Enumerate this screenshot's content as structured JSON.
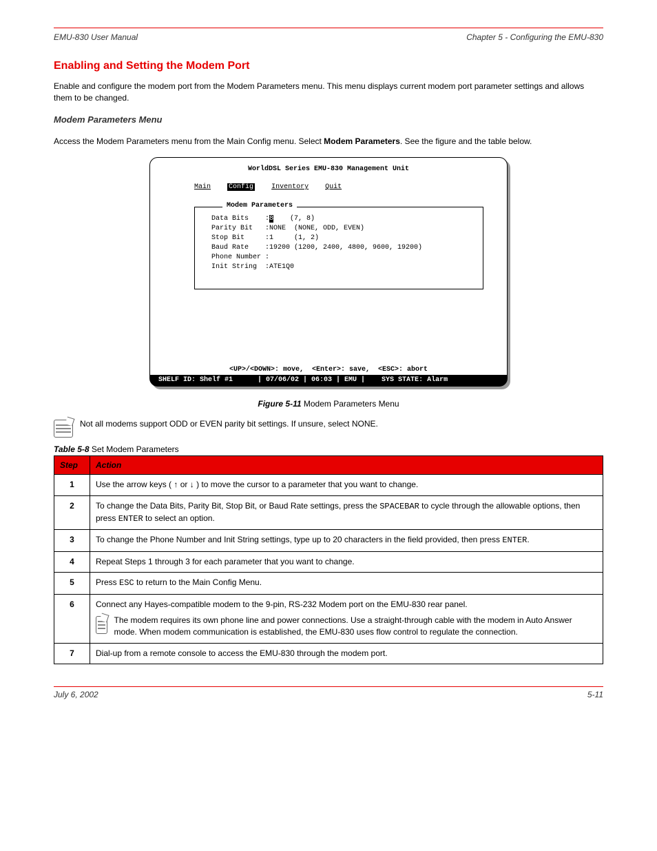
{
  "header": {
    "left": "EMU-830 User Manual",
    "right": "Chapter 5 - Configuring the EMU-830"
  },
  "section_title": "Enabling and Setting the Modem Port",
  "intro": "Enable and configure the modem port from the Modem Parameters menu. This menu displays current modem port parameter settings and allows them to be changed.",
  "subheading": "Modem Parameters Menu",
  "access_prefix": "Access the Modem Parameters menu from the Main Config menu. Select ",
  "access_bold": "Modem Parameters",
  "access_suffix": ". See the figure and the table below.",
  "terminal": {
    "title": "WorldDSL Series EMU-830 Management Unit",
    "menu": {
      "main": "Main",
      "config": "Config",
      "inventory": "Inventory",
      "quit": "Quit"
    },
    "panel_legend": "Modem Parameters",
    "rows": [
      {
        "label": "Data Bits    :",
        "value": "8",
        "hint": "(7, 8)"
      },
      {
        "label": "Parity Bit   :",
        "value": "NONE ",
        "hint": "(NONE, ODD, EVEN)"
      },
      {
        "label": "Stop Bit     :",
        "value": "1    ",
        "hint": "(1, 2)"
      },
      {
        "label": "Baud Rate    :",
        "value": "19200",
        "hint": "(1200, 2400, 4800, 9600, 19200)"
      },
      {
        "label": "Phone Number :",
        "value": "",
        "hint": ""
      },
      {
        "label": "Init String  :",
        "value": "ATE1Q0",
        "hint": ""
      }
    ],
    "help": "<UP>/<DOWN>: move,  <Enter>: save,  <ESC>: abort",
    "status": " SHELF ID: Shelf #1      | 07/06/02 | 06:03 | EMU |    SYS STATE: Alarm  "
  },
  "figure_caption_label": "Figure 5-11  ",
  "figure_caption_text": "Modem Parameters Menu",
  "note_outer": "Not all modems support ODD or EVEN parity bit settings. If unsure, select NONE.",
  "table_caption_label": "Table 5-8  ",
  "table_caption_text": "Set Modem Parameters",
  "table": {
    "headers": {
      "step": "Step",
      "action": "Action"
    },
    "rows": [
      {
        "num": "1",
        "parts": [
          {
            "t": "Use the arrow keys ("
          },
          {
            "t": " ↑ ",
            "cls": "arrow-box"
          },
          {
            "t": " or "
          },
          {
            "t": " ↓ ",
            "cls": "arrow-box"
          },
          {
            "t": " ) to move the cursor to a parameter that you want to change."
          }
        ]
      },
      {
        "num": "2",
        "parts": [
          {
            "t": "To change the Data Bits, Parity Bit, Stop Bit, or Baud Rate settings, press the "
          },
          {
            "t": "SPACEBAR",
            "cls": "mono"
          },
          {
            "t": " to cycle through the allowable options, then press "
          },
          {
            "t": "ENTER",
            "cls": "mono"
          },
          {
            "t": " to select an option."
          }
        ]
      },
      {
        "num": "3",
        "parts": [
          {
            "t": "To change the Phone Number and Init String settings, type up to 20 characters in the field provided, then press "
          },
          {
            "t": "ENTER",
            "cls": "mono"
          },
          {
            "t": "."
          }
        ]
      },
      {
        "num": "4",
        "parts": [
          {
            "t": "Repeat Steps 1 through 3 for each parameter that you want to change."
          }
        ]
      },
      {
        "num": "5",
        "parts": [
          {
            "t": "Press "
          },
          {
            "t": "ESC",
            "cls": "mono"
          },
          {
            "t": " to return to the Main Config Menu."
          }
        ]
      },
      {
        "num": "6",
        "parts": [
          {
            "t": "Connect any Hayes-compatible modem to the 9-pin, RS-232 Modem port on the EMU-830 rear panel."
          }
        ],
        "note": "The modem requires its own phone line and power connections. Use a straight-through cable with the modem in Auto Answer mode. When modem communication is established, the EMU-830 uses flow control to regulate the connection."
      },
      {
        "num": "7",
        "parts": [
          {
            "t": "Dial-up from a remote console to access the EMU-830 through the modem port."
          }
        ]
      }
    ]
  },
  "footer": {
    "left": "July 6, 2002",
    "right": "5-11"
  }
}
